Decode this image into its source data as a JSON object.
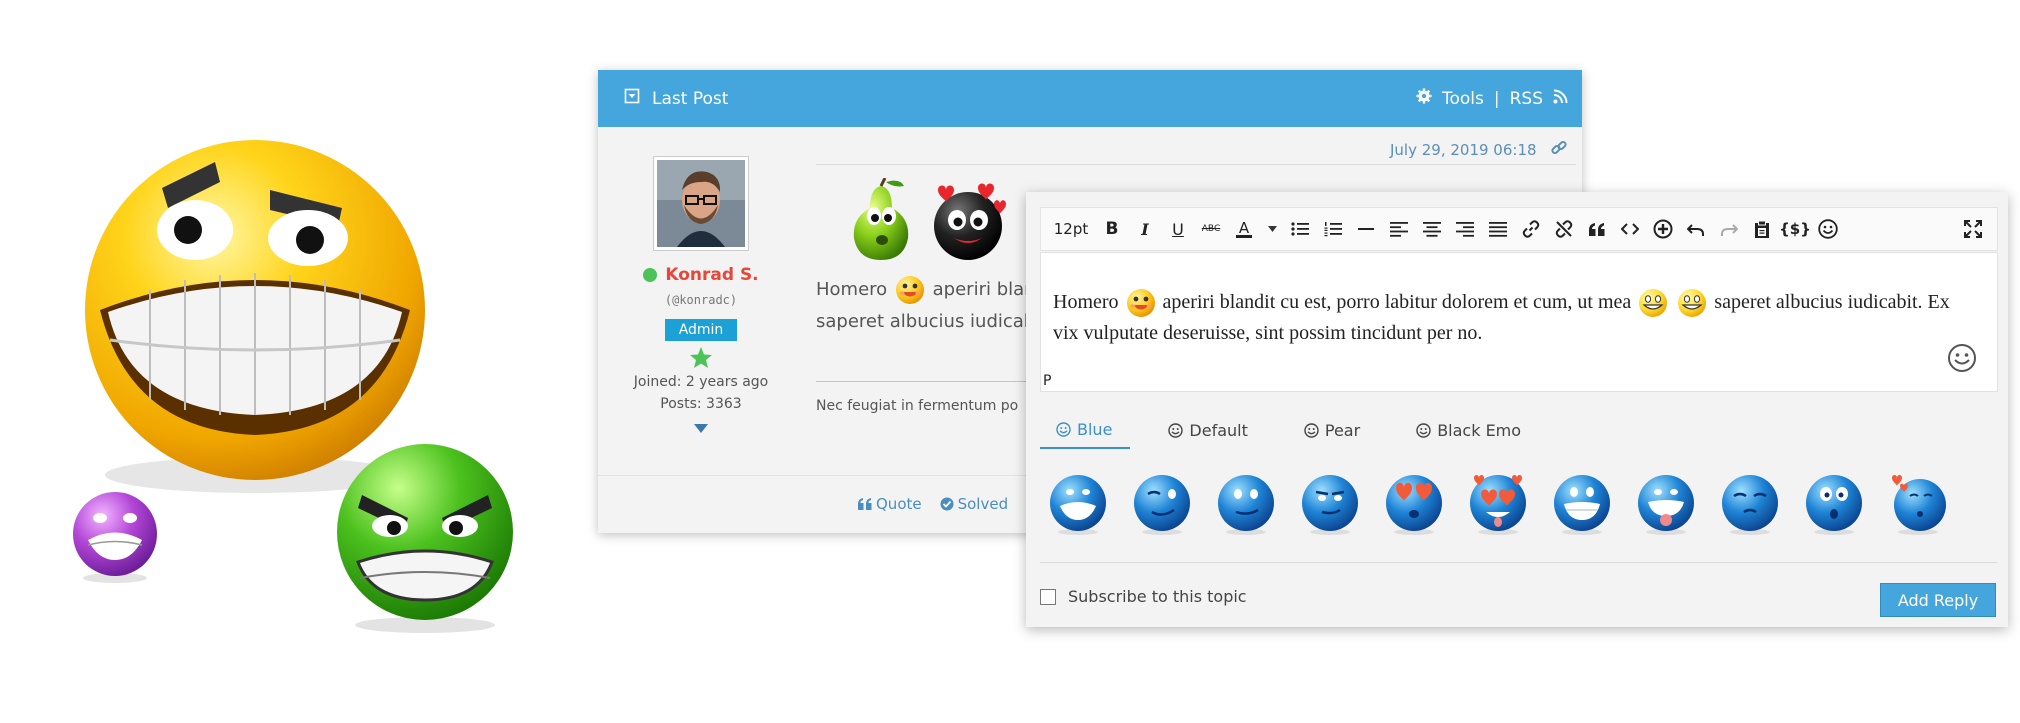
{
  "forum": {
    "header_title": "Last Post",
    "tools_label": "Tools",
    "separator": "|",
    "rss_label": "RSS",
    "post_date": "July 29, 2019 06:18",
    "user": {
      "name": "Konrad S.",
      "handle": "(@konradc)",
      "role": "Admin",
      "joined": "Joined: 2 years ago",
      "posts": "Posts: 3363"
    },
    "post_text_1": "Homero",
    "post_text_2": "aperiri blar",
    "post_text_3": "saperet albucius iudicabi",
    "signature": "Nec feugiat in fermentum po",
    "actions": {
      "quote": "Quote",
      "solved": "Solved"
    }
  },
  "editor": {
    "font_size": "12pt",
    "content_1": "Homero",
    "content_2": "aperiri blandit cu est, porro labitur dolorem et cum, ut mea",
    "content_3": "saperet albucius iudicabit. Ex vix vulputate deseruisse, sint possim tincidunt per no.",
    "path_label": "P",
    "tabs": [
      "Blue",
      "Default",
      "Pear",
      "Black Emo"
    ],
    "active_tab": "Blue",
    "subscribe_label": "Subscribe to this topic",
    "reply_button": "Add Reply"
  },
  "colors": {
    "header_blue": "#44a6dd",
    "username_red": "#e8463b",
    "admin_badge": "#1ba1d6",
    "online_green": "#4cc356"
  },
  "icons": [
    "laughing-emoji",
    "purple-grimace-emoji",
    "green-angry-emoji",
    "pear-emoji",
    "black-love-emoji",
    "blue-emoji-set",
    "smiley-icon",
    "gear-icon",
    "rss-icon",
    "link-icon",
    "quote-icon",
    "check-icon",
    "pin-icon",
    "fullscreen-icon"
  ]
}
